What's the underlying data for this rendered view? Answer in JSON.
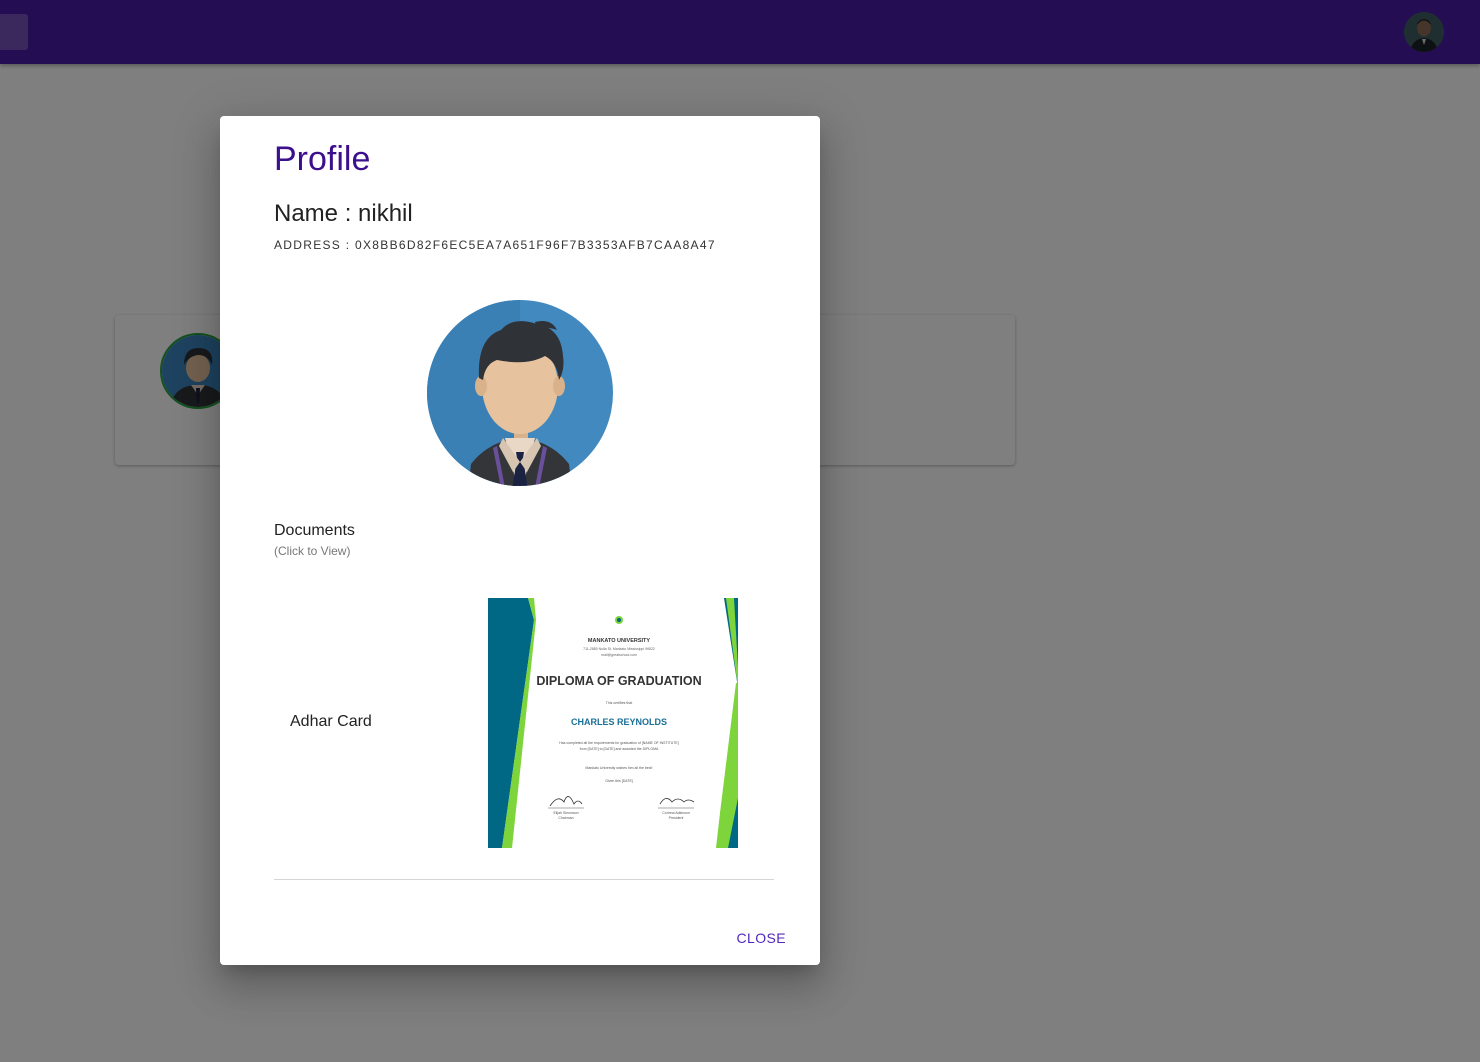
{
  "app": {
    "accent_color": "#4a1aa6",
    "avatar_icon": "user-avatar-icon",
    "menu_icon": "menu-icon"
  },
  "profile_dialog": {
    "title": "Profile",
    "name_line": "Name : nikhil",
    "address_line": "ADDRESS : 0X8BB6D82F6EC5EA7A651F96F7B3353AFB7CAA8A47",
    "profile_picture_icon": "person-avatar-icon",
    "documents_heading": "Documents",
    "documents_hint": "(Click to View)",
    "documents": [
      {
        "label": "Adhar Card",
        "thumbnail": {
          "institution": "MANKATO UNIVERSITY",
          "address": "711-2880 Nulla St. Mankato Mississippi 96522",
          "email": "mail@greatschool.com",
          "heading": "DIPLOMA OF GRADUATION",
          "certifies": "This certifies that",
          "recipient": "CHARLES REYNOLDS",
          "body_line1": "Has completed all the requirements for graduation of [NAME OF INSTITUTE]",
          "body_line2": "from [DATE] to [DATE] and awarded the DIPLOMA",
          "wish_line": "Mankato University wishes him all the best!",
          "given_line": "Given this [DATE]",
          "signer_left_name": "Elijah Simonson",
          "signer_left_role": "Chairman",
          "signer_right_name": "Corinna Adkinson",
          "signer_right_role": "President"
        }
      }
    ],
    "close_label": "CLOSE"
  }
}
